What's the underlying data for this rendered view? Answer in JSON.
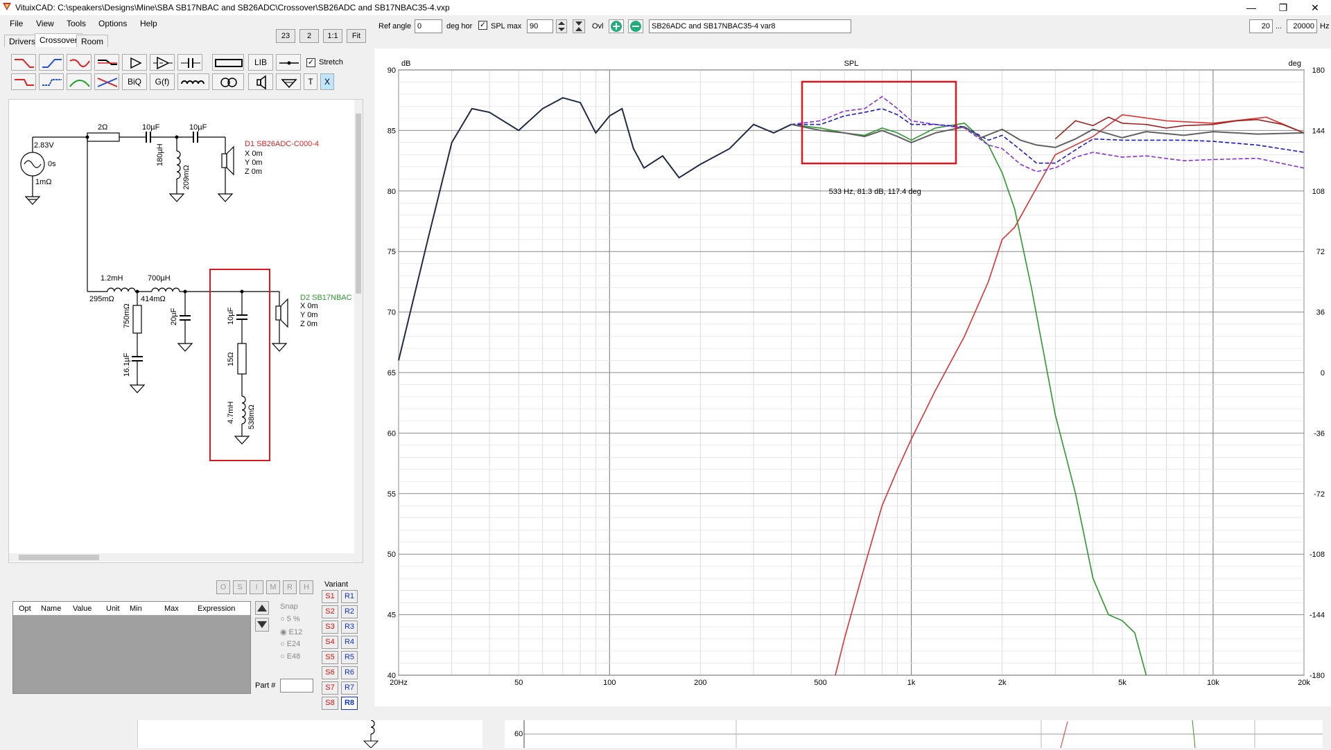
{
  "window": {
    "title": "VituixCAD: C:\\speakers\\Designs\\Mine\\SBA SB17NBAC and SB26ADC\\Crossover\\SB26ADC and SB17NBAC35-4.vxp"
  },
  "menu": [
    "File",
    "View",
    "Tools",
    "Options",
    "Help"
  ],
  "tabs": [
    "Drivers",
    "Crossover",
    "Room"
  ],
  "topbuttons": [
    "23",
    "2",
    "1:1",
    "Fit"
  ],
  "toolbar": {
    "lib_label": "LIB",
    "biq_label": "BiQ",
    "gf_label": "G(f)",
    "t_label": "T",
    "x_label": "X",
    "stretch_label": "Stretch"
  },
  "graph_toolbar": {
    "ref_angle_label": "Ref angle",
    "ref_angle_value": "0",
    "deg_hor_label": "deg hor",
    "spl_max_label": "SPL max",
    "spl_max_value": "90",
    "ovl_label": "Ovl",
    "overlay_name": "SB26ADC and SB17NBAC35-4 var8",
    "freq_min": "20",
    "freq_max": "20000",
    "dots": "...",
    "hz": "Hz"
  },
  "schematic": {
    "generator": {
      "voltage": "2.83V",
      "delay": "0s",
      "resistance": "1mΩ"
    },
    "tweeter_path": {
      "r1": "2Ω",
      "c1": "10µF",
      "c2": "10µF",
      "l1": "180µH",
      "l1_r": "209mΩ"
    },
    "driver1": {
      "name": "D1 SB26ADC-C000-4",
      "x": "X 0m",
      "y": "Y 0m",
      "z": "Z 0m"
    },
    "woofer_path": {
      "l1": "1.2mH",
      "l1_r": "295mΩ",
      "l2": "700µH",
      "l2_r": "414mΩ",
      "r1": "750mΩ",
      "c1": "16.1µF",
      "c2": "20µF"
    },
    "notch": {
      "c": "10µF",
      "r": "15Ω",
      "l": "4.7mH",
      "l_r": "538mΩ"
    },
    "driver2": {
      "name": "D2 SB17NBAC",
      "x": "X 0m",
      "y": "Y 0m",
      "z": "Z 0m"
    }
  },
  "letter_buttons": [
    "O",
    "S",
    "I",
    "M",
    "R",
    "H"
  ],
  "param_table": {
    "headers": [
      "Opt",
      "Name",
      "Value",
      "Unit",
      "Min",
      "Max",
      "Expression"
    ]
  },
  "snap": {
    "label": "Snap",
    "options": [
      "5 %",
      "E12",
      "E24",
      "E48"
    ],
    "selected": "E12"
  },
  "part_label": "Part #",
  "variant": {
    "label": "Variant",
    "s": [
      "S1",
      "S2",
      "S3",
      "S4",
      "S5",
      "S6",
      "S7",
      "S8"
    ],
    "r": [
      "R1",
      "R2",
      "R3",
      "R4",
      "R5",
      "R6",
      "R7",
      "R8"
    ],
    "selected": "R8"
  },
  "colors": {
    "highlight": "#e0141e",
    "total": "#606060",
    "tweeter": "#e03030",
    "woofer": "#2a9a2a",
    "overlay_blue": "#1a1acc",
    "overlay_violet": "#8a2be2",
    "dark": "#1e2a44",
    "darkred": "#a02020"
  },
  "chart_data": {
    "type": "line",
    "title": "SPL",
    "ylabel_left": "dB",
    "ylabel_right": "deg",
    "xscale": "log",
    "xlim": [
      20,
      20000
    ],
    "ylim": [
      40,
      90
    ],
    "ylim_right": [
      -180,
      180
    ],
    "x_tick_labels": [
      "20Hz",
      "50",
      "100",
      "200",
      "500",
      "1k",
      "2k",
      "5k",
      "10k",
      "20k"
    ],
    "x_tick_values": [
      20,
      50,
      100,
      200,
      500,
      1000,
      2000,
      5000,
      10000,
      20000
    ],
    "y_ticks": [
      40,
      45,
      50,
      55,
      60,
      65,
      70,
      75,
      80,
      85,
      90
    ],
    "y_ticks_right": [
      -180,
      -144,
      -108,
      -72,
      -36,
      0,
      36,
      72,
      108,
      144,
      180
    ],
    "cursor_readout": "533 Hz, 81.3 dB, 117.4 deg",
    "grid": true,
    "series": [
      {
        "key": "low_common",
        "color": "#1e2a44",
        "x": [
          20,
          25,
          30,
          35,
          40,
          50,
          60,
          70,
          80,
          90,
          100,
          110,
          120,
          130,
          150,
          170,
          200,
          250,
          300,
          350,
          400
        ],
        "y": [
          66,
          76,
          84,
          86.8,
          86.5,
          85,
          86.8,
          87.7,
          87.3,
          84.8,
          86.2,
          86.8,
          83.5,
          81.9,
          82.9,
          81.1,
          82.2,
          83.5,
          85.5,
          84.8,
          85.5
        ]
      },
      {
        "key": "total",
        "color": "#606060",
        "x": [
          400,
          500,
          600,
          700,
          800,
          900,
          1000,
          1200,
          1500,
          1700,
          2000,
          2300,
          2600,
          3000,
          3500,
          4000,
          5000,
          6000,
          8000,
          10000,
          14000,
          20000
        ],
        "y": [
          85.5,
          85,
          84.8,
          84.5,
          85,
          84.5,
          84,
          84.8,
          85.3,
          84.4,
          85.1,
          84.2,
          83.8,
          83.6,
          84.3,
          85.1,
          84.4,
          84.9,
          84.6,
          84.9,
          84.7,
          84.8
        ]
      },
      {
        "key": "tweeter",
        "color": "#e03030",
        "x": [
          560,
          600,
          700,
          800,
          900,
          1000,
          1200,
          1500,
          1800,
          2000,
          2200,
          2500,
          3000,
          4000,
          5000,
          7000,
          10000,
          15000,
          20000
        ],
        "y": [
          40,
          43,
          49,
          54,
          57,
          59.5,
          63.5,
          68,
          72.5,
          76,
          77,
          79.5,
          83,
          84.5,
          86.3,
          85.8,
          85.6,
          86.1,
          84.8
        ]
      },
      {
        "key": "woofer",
        "color": "#2a9a2a",
        "x": [
          400,
          500,
          600,
          700,
          800,
          900,
          1000,
          1200,
          1500,
          1800,
          2000,
          2200,
          2500,
          3000,
          3500,
          4000,
          4500,
          5000,
          5500,
          6000
        ],
        "y": [
          85.5,
          85.2,
          84.8,
          84.6,
          85.2,
          84.8,
          84.2,
          85.2,
          85.6,
          83.8,
          81.5,
          78.5,
          72,
          61.5,
          55,
          48,
          45,
          44.5,
          43.5,
          40
        ]
      },
      {
        "key": "overlay_blue",
        "color": "#1a1acc",
        "dashed": true,
        "x": [
          400,
          500,
          600,
          700,
          800,
          900,
          1000,
          1200,
          1500,
          1800,
          2000,
          2300,
          2600,
          3000,
          3500,
          4000,
          5000,
          6000,
          8000,
          10000,
          14000,
          20000
        ],
        "y": [
          85.5,
          85.5,
          86.2,
          86.5,
          86.8,
          86.3,
          85.5,
          85.5,
          85.3,
          84.2,
          84.6,
          83.4,
          82.3,
          82.3,
          83.4,
          84.3,
          84.2,
          84.2,
          84.2,
          84.1,
          83.8,
          83.2
        ]
      },
      {
        "key": "overlay_violet",
        "color": "#8a2be2",
        "dashed": true,
        "x": [
          400,
          500,
          600,
          700,
          800,
          900,
          1000,
          1200,
          1500,
          1800,
          2000,
          2300,
          2600,
          3000,
          3500,
          4000,
          5000,
          6000,
          8000,
          10000,
          14000,
          20000
        ],
        "y": [
          85.5,
          85.8,
          86.6,
          86.8,
          87.8,
          86.8,
          85.8,
          85.5,
          85.2,
          83.8,
          83.5,
          82.2,
          81.6,
          81.9,
          82.8,
          83.2,
          82.8,
          82.9,
          82.5,
          82.6,
          82.7,
          81.9
        ]
      },
      {
        "key": "top_darkred",
        "color": "#a02020",
        "x": [
          3000,
          3500,
          4000,
          4500,
          5000,
          6000,
          7000,
          8000,
          10000,
          12000,
          14000,
          17000,
          20000
        ],
        "y": [
          84.3,
          85.8,
          85.4,
          86.1,
          85.6,
          85.5,
          85.2,
          85.4,
          85.5,
          85.8,
          85.9,
          85.5,
          84.8
        ]
      }
    ]
  }
}
